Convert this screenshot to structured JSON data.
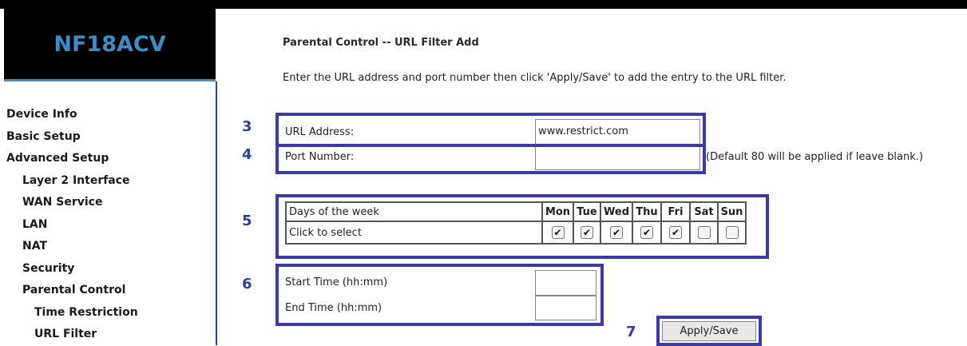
{
  "brand": {
    "name": "NF18ACV"
  },
  "sidebar": {
    "items": [
      {
        "label": "Device Info"
      },
      {
        "label": "Basic Setup"
      },
      {
        "label": "Advanced Setup"
      },
      {
        "label": "Layer 2 Interface"
      },
      {
        "label": "WAN Service"
      },
      {
        "label": "LAN"
      },
      {
        "label": "NAT"
      },
      {
        "label": "Security"
      },
      {
        "label": "Parental Control"
      },
      {
        "label": "Time Restriction"
      },
      {
        "label": "URL Filter"
      }
    ]
  },
  "main": {
    "title": "Parental Control -- URL Filter Add",
    "description": "Enter the URL address and port number then click 'Apply/Save' to add the entry to the URL filter.",
    "url_label": "URL Address:",
    "url_value": "www.restrict.com",
    "port_label": "Port Number:",
    "port_value": "",
    "port_hint": "(Default 80 will be applied if leave blank.)",
    "days_label": "Days of the week",
    "click_label": "Click to select",
    "days": [
      {
        "label": "Mon",
        "checked": true
      },
      {
        "label": "Tue",
        "checked": true
      },
      {
        "label": "Wed",
        "checked": true
      },
      {
        "label": "Thu",
        "checked": true
      },
      {
        "label": "Fri",
        "checked": true
      },
      {
        "label": "Sat",
        "checked": false
      },
      {
        "label": "Sun",
        "checked": false
      }
    ],
    "start_label": "Start Time (hh:mm)",
    "end_label": "End Time (hh:mm)",
    "apply_label": "Apply/Save"
  },
  "annotations": {
    "s3": "3",
    "s4": "4",
    "s5": "5",
    "s6": "6",
    "s7": "7"
  },
  "colors": {
    "annotation": "#3a3aaa",
    "brand_text": "#3b8ec8"
  }
}
